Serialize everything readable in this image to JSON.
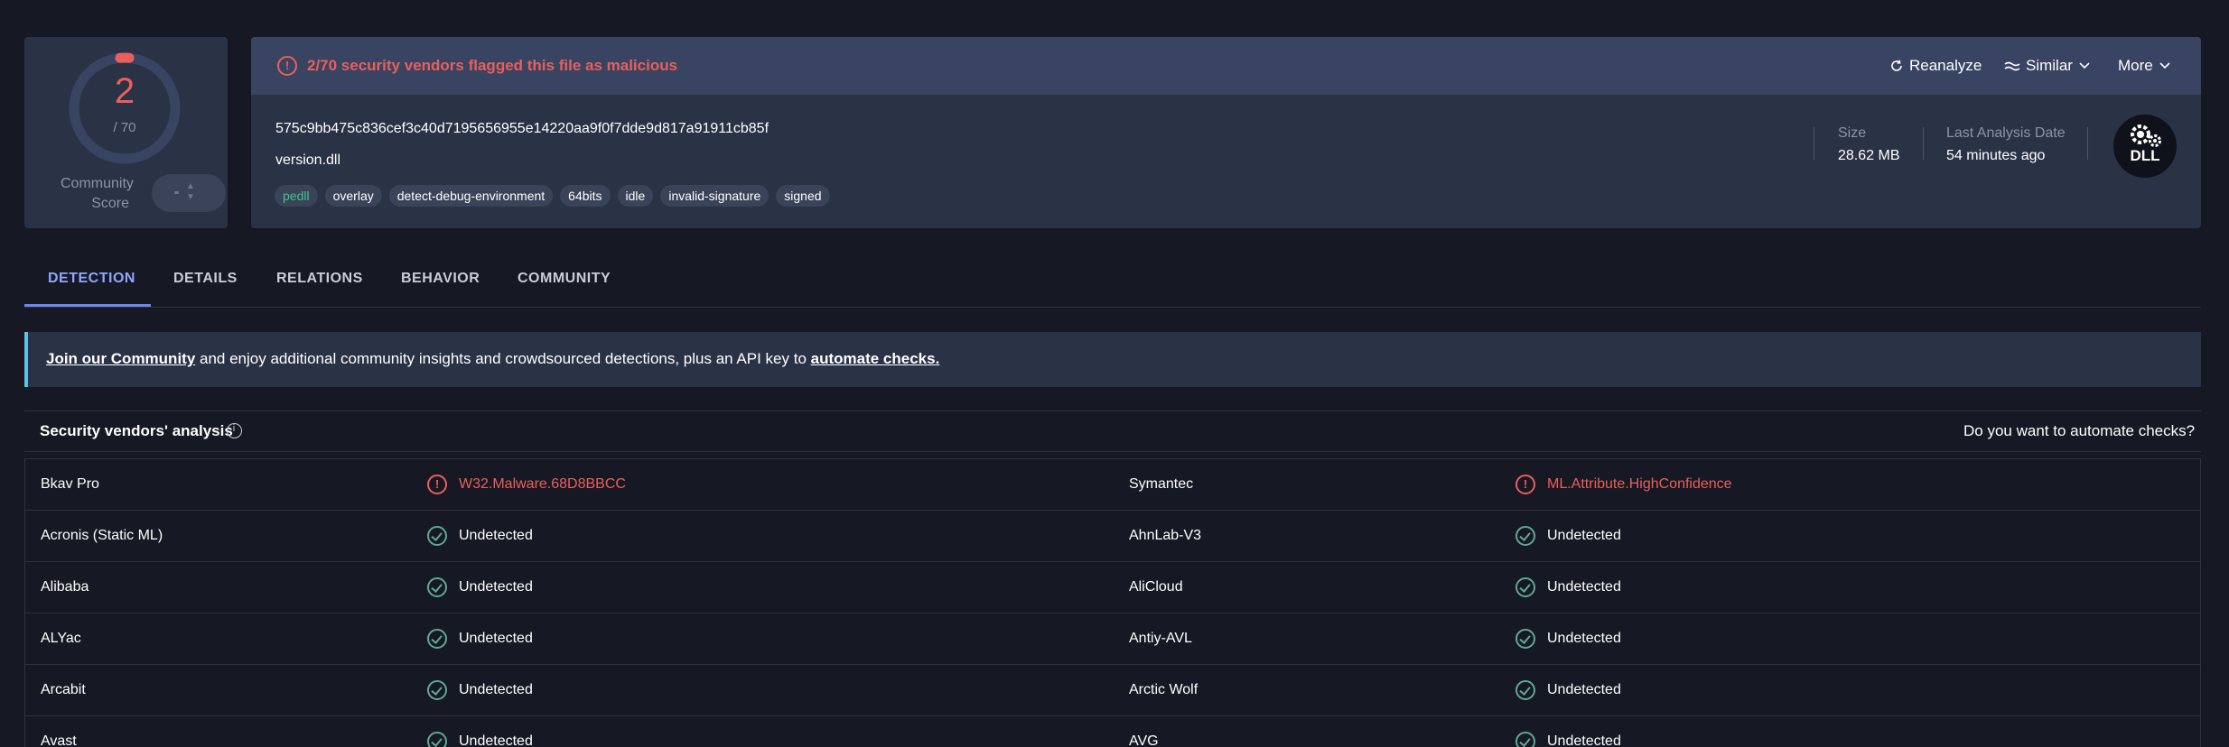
{
  "score": {
    "value": "2",
    "total": "/ 70",
    "community_label": "Community Score"
  },
  "alert": {
    "text": "2/70 security vendors flagged this file as malicious"
  },
  "actions": {
    "reanalyze": "Reanalyze",
    "similar": "Similar",
    "more": "More"
  },
  "file": {
    "hash": "575c9bb475c836cef3c40d7195656955e14220aa9f0f7dde9d817a91911cb85f",
    "name": "version.dll",
    "tags": [
      "pedll",
      "overlay",
      "detect-debug-environment",
      "64bits",
      "idle",
      "invalid-signature",
      "signed"
    ],
    "size_label": "Size",
    "size_value": "28.62 MB",
    "date_label": "Last Analysis Date",
    "date_value": "54 minutes ago",
    "type_badge": "DLL"
  },
  "tabs": [
    "DETECTION",
    "DETAILS",
    "RELATIONS",
    "BEHAVIOR",
    "COMMUNITY"
  ],
  "banner": {
    "link1": "Join our Community",
    "middle": " and enjoy additional community insights and crowdsourced detections, plus an API key to ",
    "link2": "automate checks."
  },
  "vendors_section": {
    "title": "Security vendors' analysis",
    "automate": "Do you want to automate checks?"
  },
  "vendors": [
    {
      "left": {
        "name": "Bkav Pro",
        "result": "W32.Malware.68D8BBCC",
        "status": "bad"
      },
      "right": {
        "name": "Symantec",
        "result": "ML.Attribute.HighConfidence",
        "status": "bad"
      }
    },
    {
      "left": {
        "name": "Acronis (Static ML)",
        "result": "Undetected",
        "status": "ok"
      },
      "right": {
        "name": "AhnLab-V3",
        "result": "Undetected",
        "status": "ok"
      }
    },
    {
      "left": {
        "name": "Alibaba",
        "result": "Undetected",
        "status": "ok"
      },
      "right": {
        "name": "AliCloud",
        "result": "Undetected",
        "status": "ok"
      }
    },
    {
      "left": {
        "name": "ALYac",
        "result": "Undetected",
        "status": "ok"
      },
      "right": {
        "name": "Antiy-AVL",
        "result": "Undetected",
        "status": "ok"
      }
    },
    {
      "left": {
        "name": "Arcabit",
        "result": "Undetected",
        "status": "ok"
      },
      "right": {
        "name": "Arctic Wolf",
        "result": "Undetected",
        "status": "ok"
      }
    },
    {
      "left": {
        "name": "Avast",
        "result": "Undetected",
        "status": "ok"
      },
      "right": {
        "name": "AVG",
        "result": "Undetected",
        "status": "ok"
      }
    }
  ],
  "colors": {
    "malicious": "#ea5f5c",
    "undetected": "#5fa894",
    "accent": "#8ea7ff"
  },
  "detection_fraction": 0.0286
}
